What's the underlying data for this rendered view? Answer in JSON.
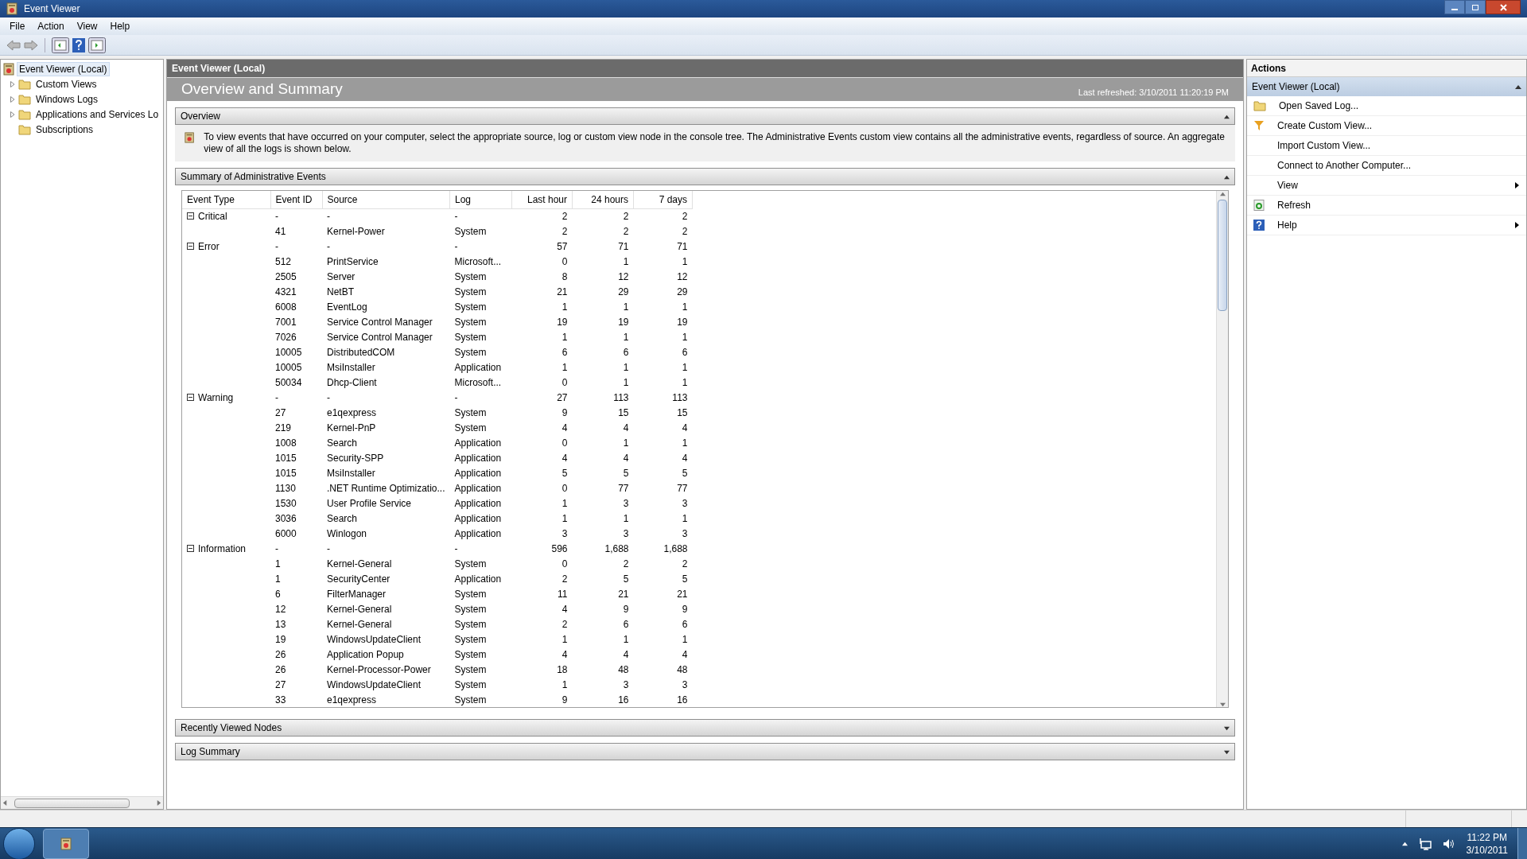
{
  "window": {
    "title": "Event Viewer"
  },
  "menu": [
    "File",
    "Action",
    "View",
    "Help"
  ],
  "tree": [
    {
      "label": "Event Viewer (Local)",
      "kind": "root",
      "selected": true,
      "children": [
        {
          "label": "Custom Views",
          "kind": "expandable",
          "expanded": false,
          "selected": false
        },
        {
          "label": "Windows Logs",
          "kind": "expandable",
          "expanded": false,
          "selected": false
        },
        {
          "label": "Applications and Services Lo",
          "kind": "expandable",
          "expanded": false,
          "selected": false
        },
        {
          "label": "Subscriptions",
          "kind": "leaf",
          "selected": false
        }
      ]
    }
  ],
  "center": {
    "header": "Event Viewer (Local)",
    "title": "Overview and Summary",
    "last_refreshed": "Last refreshed: 3/10/2011 11:20:19 PM",
    "sections": [
      {
        "title": "Overview",
        "kind": "text",
        "expanded": true,
        "text": "To view events that have occurred on your computer, select the appropriate source, log or custom view node in the console tree. The Administrative Events custom view contains all the administrative events, regardless of source. An aggregate view of all the logs is shown below."
      },
      {
        "title": "Summary of Administrative Events",
        "kind": "table",
        "expanded": true,
        "table": {
          "columns": [
            "Event Type",
            "Event ID",
            "Source",
            "Log",
            "Last hour",
            "24 hours",
            "7 days"
          ],
          "groups": [
            {
              "type": "Critical",
              "expanded": true,
              "cells": [
                "-",
                "-",
                "-",
                "2",
                "2",
                "2"
              ],
              "rows": [
                [
                  "41",
                  "Kernel-Power",
                  "System",
                  "2",
                  "2",
                  "2"
                ]
              ]
            },
            {
              "type": "Error",
              "expanded": true,
              "cells": [
                "-",
                "-",
                "-",
                "57",
                "71",
                "71"
              ],
              "rows": [
                [
                  "512",
                  "PrintService",
                  "Microsoft...",
                  "0",
                  "1",
                  "1"
                ],
                [
                  "2505",
                  "Server",
                  "System",
                  "8",
                  "12",
                  "12"
                ],
                [
                  "4321",
                  "NetBT",
                  "System",
                  "21",
                  "29",
                  "29"
                ],
                [
                  "6008",
                  "EventLog",
                  "System",
                  "1",
                  "1",
                  "1"
                ],
                [
                  "7001",
                  "Service Control Manager",
                  "System",
                  "19",
                  "19",
                  "19"
                ],
                [
                  "7026",
                  "Service Control Manager",
                  "System",
                  "1",
                  "1",
                  "1"
                ],
                [
                  "10005",
                  "DistributedCOM",
                  "System",
                  "6",
                  "6",
                  "6"
                ],
                [
                  "10005",
                  "MsiInstaller",
                  "Application",
                  "1",
                  "1",
                  "1"
                ],
                [
                  "50034",
                  "Dhcp-Client",
                  "Microsoft...",
                  "0",
                  "1",
                  "1"
                ]
              ]
            },
            {
              "type": "Warning",
              "expanded": true,
              "cells": [
                "-",
                "-",
                "-",
                "27",
                "113",
                "113"
              ],
              "rows": [
                [
                  "27",
                  "e1qexpress",
                  "System",
                  "9",
                  "15",
                  "15"
                ],
                [
                  "219",
                  "Kernel-PnP",
                  "System",
                  "4",
                  "4",
                  "4"
                ],
                [
                  "1008",
                  "Search",
                  "Application",
                  "0",
                  "1",
                  "1"
                ],
                [
                  "1015",
                  "Security-SPP",
                  "Application",
                  "4",
                  "4",
                  "4"
                ],
                [
                  "1015",
                  "MsiInstaller",
                  "Application",
                  "5",
                  "5",
                  "5"
                ],
                [
                  "1130",
                  ".NET Runtime Optimizatio...",
                  "Application",
                  "0",
                  "77",
                  "77"
                ],
                [
                  "1530",
                  "User Profile Service",
                  "Application",
                  "1",
                  "3",
                  "3"
                ],
                [
                  "3036",
                  "Search",
                  "Application",
                  "1",
                  "1",
                  "1"
                ],
                [
                  "6000",
                  "Winlogon",
                  "Application",
                  "3",
                  "3",
                  "3"
                ]
              ]
            },
            {
              "type": "Information",
              "expanded": true,
              "cells": [
                "-",
                "-",
                "-",
                "596",
                "1,688",
                "1,688"
              ],
              "rows": [
                [
                  "1",
                  "Kernel-General",
                  "System",
                  "0",
                  "2",
                  "2"
                ],
                [
                  "1",
                  "SecurityCenter",
                  "Application",
                  "2",
                  "5",
                  "5"
                ],
                [
                  "6",
                  "FilterManager",
                  "System",
                  "11",
                  "21",
                  "21"
                ],
                [
                  "12",
                  "Kernel-General",
                  "System",
                  "4",
                  "9",
                  "9"
                ],
                [
                  "13",
                  "Kernel-General",
                  "System",
                  "2",
                  "6",
                  "6"
                ],
                [
                  "19",
                  "WindowsUpdateClient",
                  "System",
                  "1",
                  "1",
                  "1"
                ],
                [
                  "26",
                  "Application Popup",
                  "System",
                  "4",
                  "4",
                  "4"
                ],
                [
                  "26",
                  "Kernel-Processor-Power",
                  "System",
                  "18",
                  "48",
                  "48"
                ],
                [
                  "27",
                  "WindowsUpdateClient",
                  "System",
                  "1",
                  "3",
                  "3"
                ],
                [
                  "33",
                  "e1qexpress",
                  "System",
                  "9",
                  "16",
                  "16"
                ]
              ]
            }
          ]
        }
      },
      {
        "title": "Recently Viewed Nodes",
        "expanded": false
      },
      {
        "title": "Log Summary",
        "expanded": false
      }
    ]
  },
  "actions": {
    "title": "Actions",
    "group": {
      "title": "Event Viewer (Local)",
      "expanded": true
    },
    "items": [
      {
        "label": "Open Saved Log...",
        "kind": "action"
      },
      {
        "label": "Create Custom View...",
        "kind": "action"
      },
      {
        "label": "Import Custom View...",
        "kind": "action"
      },
      {
        "label": "Connect to Another Computer...",
        "kind": "action"
      },
      {
        "label": "View",
        "kind": "submenu"
      },
      {
        "label": "Refresh",
        "kind": "action"
      },
      {
        "label": "Help",
        "kind": "submenu"
      }
    ]
  },
  "taskbar": {
    "time": "11:22 PM",
    "date": "3/10/2011"
  }
}
